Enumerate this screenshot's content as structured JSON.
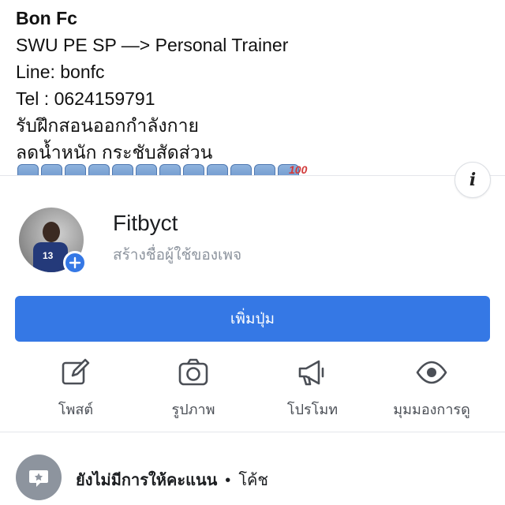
{
  "cover": {
    "lines": [
      "Bon Fc",
      "SWU PE SP —> Personal Trainer",
      "Line: bonfc",
      "Tel : 0624159791",
      "รับฝึกสอนออกกำลังกาย",
      "ลดน้ำหนัก กระชับสัดส่วน"
    ],
    "hundred_emoji": "100"
  },
  "profile": {
    "page_name": "Fitbyct",
    "username_prompt": "สร้างชื่อผู้ใช้ของเพจ"
  },
  "add_button": {
    "label": "เพิ่มปุ่ม"
  },
  "actions": [
    {
      "label": "โพสต์",
      "icon": "edit-icon"
    },
    {
      "label": "รูปภาพ",
      "icon": "camera-icon"
    },
    {
      "label": "โปรโมท",
      "icon": "megaphone-icon"
    },
    {
      "label": "มุมมองการดู",
      "icon": "eye-icon"
    }
  ],
  "rating": {
    "status": "ยังไม่มีการให้คะแนน",
    "separator": "•",
    "category": "โค้ช"
  },
  "colors": {
    "accent": "#3578e5",
    "muted": "#8d949e"
  }
}
